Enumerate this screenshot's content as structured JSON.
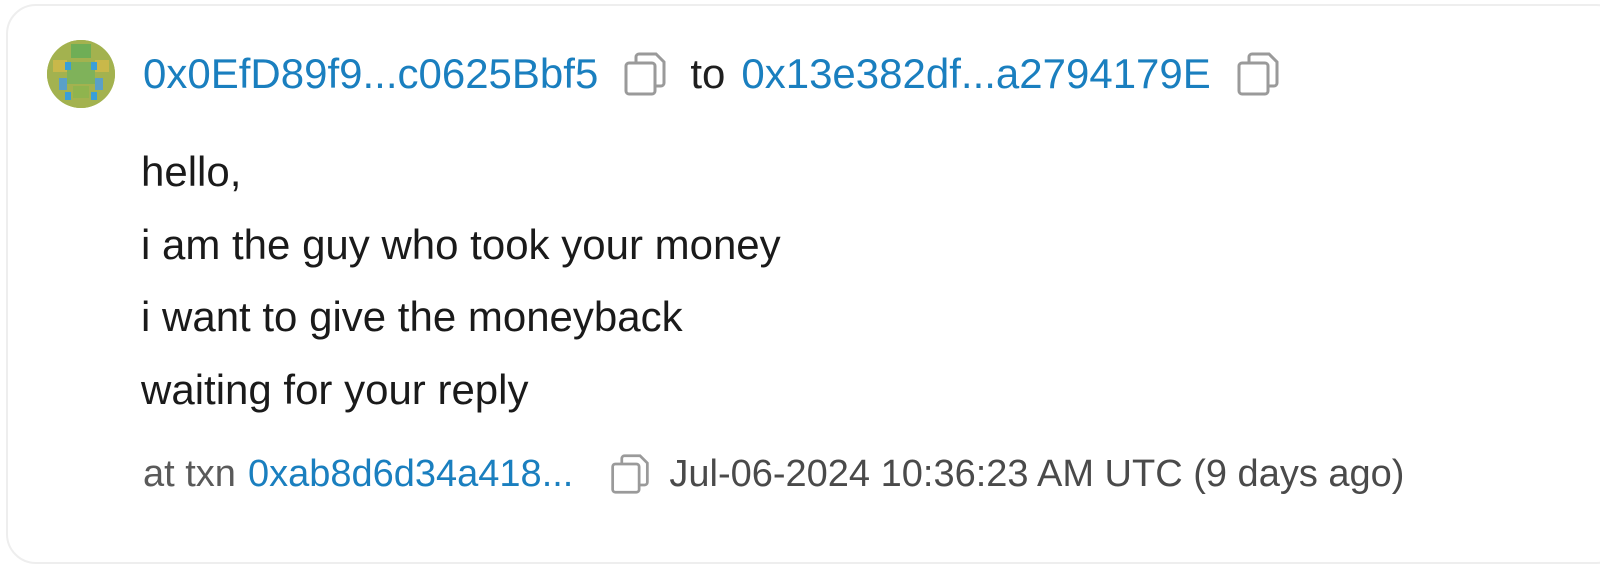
{
  "message": {
    "from_address": "0x0EfD89f9...c0625Bbf5",
    "to_word": "to",
    "to_address": "0x13e382df...a2794179E",
    "lines": [
      "hello,",
      "i am the guy who took your money",
      "i want to give the moneyback",
      "waiting for your reply"
    ],
    "txn_prefix": "at txn",
    "txn_hash": "0xab8d6d34a418...",
    "timestamp": "Jul-06-2024 10:36:23 AM UTC (9 days ago)"
  },
  "icons": {
    "avatar": "identicon-avatar",
    "copy": "copy-icon"
  },
  "colors": {
    "link": "#1a7fbf",
    "text": "#1a1a1a",
    "muted": "#5a5a5a",
    "icon": "#9a9a9a"
  }
}
